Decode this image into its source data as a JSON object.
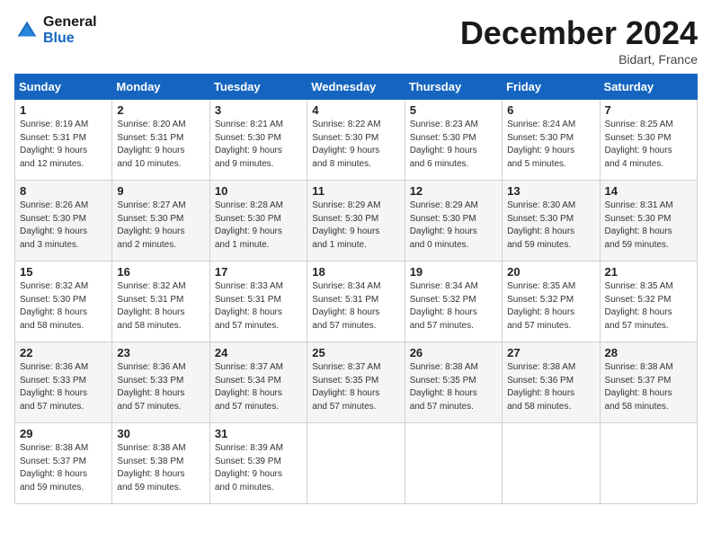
{
  "header": {
    "logo_line1": "General",
    "logo_line2": "Blue",
    "month": "December 2024",
    "location": "Bidart, France"
  },
  "days_of_week": [
    "Sunday",
    "Monday",
    "Tuesday",
    "Wednesday",
    "Thursday",
    "Friday",
    "Saturday"
  ],
  "weeks": [
    [
      {
        "day": 1,
        "content": "Sunrise: 8:19 AM\nSunset: 5:31 PM\nDaylight: 9 hours\nand 12 minutes."
      },
      {
        "day": 2,
        "content": "Sunrise: 8:20 AM\nSunset: 5:31 PM\nDaylight: 9 hours\nand 10 minutes."
      },
      {
        "day": 3,
        "content": "Sunrise: 8:21 AM\nSunset: 5:30 PM\nDaylight: 9 hours\nand 9 minutes."
      },
      {
        "day": 4,
        "content": "Sunrise: 8:22 AM\nSunset: 5:30 PM\nDaylight: 9 hours\nand 8 minutes."
      },
      {
        "day": 5,
        "content": "Sunrise: 8:23 AM\nSunset: 5:30 PM\nDaylight: 9 hours\nand 6 minutes."
      },
      {
        "day": 6,
        "content": "Sunrise: 8:24 AM\nSunset: 5:30 PM\nDaylight: 9 hours\nand 5 minutes."
      },
      {
        "day": 7,
        "content": "Sunrise: 8:25 AM\nSunset: 5:30 PM\nDaylight: 9 hours\nand 4 minutes."
      }
    ],
    [
      {
        "day": 8,
        "content": "Sunrise: 8:26 AM\nSunset: 5:30 PM\nDaylight: 9 hours\nand 3 minutes."
      },
      {
        "day": 9,
        "content": "Sunrise: 8:27 AM\nSunset: 5:30 PM\nDaylight: 9 hours\nand 2 minutes."
      },
      {
        "day": 10,
        "content": "Sunrise: 8:28 AM\nSunset: 5:30 PM\nDaylight: 9 hours\nand 1 minute."
      },
      {
        "day": 11,
        "content": "Sunrise: 8:29 AM\nSunset: 5:30 PM\nDaylight: 9 hours\nand 1 minute."
      },
      {
        "day": 12,
        "content": "Sunrise: 8:29 AM\nSunset: 5:30 PM\nDaylight: 9 hours\nand 0 minutes."
      },
      {
        "day": 13,
        "content": "Sunrise: 8:30 AM\nSunset: 5:30 PM\nDaylight: 8 hours\nand 59 minutes."
      },
      {
        "day": 14,
        "content": "Sunrise: 8:31 AM\nSunset: 5:30 PM\nDaylight: 8 hours\nand 59 minutes."
      }
    ],
    [
      {
        "day": 15,
        "content": "Sunrise: 8:32 AM\nSunset: 5:30 PM\nDaylight: 8 hours\nand 58 minutes."
      },
      {
        "day": 16,
        "content": "Sunrise: 8:32 AM\nSunset: 5:31 PM\nDaylight: 8 hours\nand 58 minutes."
      },
      {
        "day": 17,
        "content": "Sunrise: 8:33 AM\nSunset: 5:31 PM\nDaylight: 8 hours\nand 57 minutes."
      },
      {
        "day": 18,
        "content": "Sunrise: 8:34 AM\nSunset: 5:31 PM\nDaylight: 8 hours\nand 57 minutes."
      },
      {
        "day": 19,
        "content": "Sunrise: 8:34 AM\nSunset: 5:32 PM\nDaylight: 8 hours\nand 57 minutes."
      },
      {
        "day": 20,
        "content": "Sunrise: 8:35 AM\nSunset: 5:32 PM\nDaylight: 8 hours\nand 57 minutes."
      },
      {
        "day": 21,
        "content": "Sunrise: 8:35 AM\nSunset: 5:32 PM\nDaylight: 8 hours\nand 57 minutes."
      }
    ],
    [
      {
        "day": 22,
        "content": "Sunrise: 8:36 AM\nSunset: 5:33 PM\nDaylight: 8 hours\nand 57 minutes."
      },
      {
        "day": 23,
        "content": "Sunrise: 8:36 AM\nSunset: 5:33 PM\nDaylight: 8 hours\nand 57 minutes."
      },
      {
        "day": 24,
        "content": "Sunrise: 8:37 AM\nSunset: 5:34 PM\nDaylight: 8 hours\nand 57 minutes."
      },
      {
        "day": 25,
        "content": "Sunrise: 8:37 AM\nSunset: 5:35 PM\nDaylight: 8 hours\nand 57 minutes."
      },
      {
        "day": 26,
        "content": "Sunrise: 8:38 AM\nSunset: 5:35 PM\nDaylight: 8 hours\nand 57 minutes."
      },
      {
        "day": 27,
        "content": "Sunrise: 8:38 AM\nSunset: 5:36 PM\nDaylight: 8 hours\nand 58 minutes."
      },
      {
        "day": 28,
        "content": "Sunrise: 8:38 AM\nSunset: 5:37 PM\nDaylight: 8 hours\nand 58 minutes."
      }
    ],
    [
      {
        "day": 29,
        "content": "Sunrise: 8:38 AM\nSunset: 5:37 PM\nDaylight: 8 hours\nand 59 minutes."
      },
      {
        "day": 30,
        "content": "Sunrise: 8:38 AM\nSunset: 5:38 PM\nDaylight: 8 hours\nand 59 minutes."
      },
      {
        "day": 31,
        "content": "Sunrise: 8:39 AM\nSunset: 5:39 PM\nDaylight: 9 hours\nand 0 minutes."
      },
      null,
      null,
      null,
      null
    ]
  ]
}
